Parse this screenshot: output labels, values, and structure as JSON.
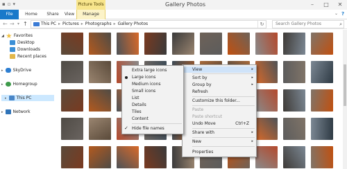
{
  "titlebar": {
    "title": "Gallery Photos",
    "contextual_tab_title": "Picture Tools",
    "qat": [
      "▪",
      "▫",
      "▾"
    ],
    "buttons": [
      "–",
      "□",
      "✕"
    ]
  },
  "ribbon": {
    "tabs": [
      "File",
      "Home",
      "Share",
      "View",
      "Manage"
    ],
    "expand_glyph": "⌄",
    "help_glyph": "?"
  },
  "address": {
    "back": "←",
    "forward": "→",
    "recent": "▾",
    "up": "↑",
    "crumbs": [
      "This PC",
      "Pictures",
      "Photographs",
      "Gallery Photos"
    ],
    "separator": "▸",
    "refresh": "↻",
    "search_placeholder": "Search Gallery Photos",
    "search_glyph": "⌕"
  },
  "nav": {
    "favorites": "Favorites",
    "desktop": "Desktop",
    "downloads": "Downloads",
    "recent_places": "Recent places",
    "skydrive": "SkyDrive",
    "homegroup": "Homegroup",
    "this_pc": "This PC",
    "network": "Network",
    "expand": "▸"
  },
  "context_menu": {
    "items": {
      "view": "View",
      "sort_by": "Sort by",
      "group_by": "Group by",
      "refresh": "Refresh",
      "customize": "Customize this folder...",
      "paste": "Paste",
      "paste_shortcut": "Paste shortcut",
      "undo_move": "Undo Move",
      "undo_shortcut": "Ctrl+Z",
      "share_with": "Share with",
      "new": "New",
      "properties": "Properties"
    },
    "arrow": "▸"
  },
  "view_submenu": {
    "items": [
      "Extra large icons",
      "Large icons",
      "Medium icons",
      "Small icons",
      "List",
      "Details",
      "Tiles",
      "Content",
      "Hide file names"
    ],
    "selected": "Large icons",
    "checked": "Hide file names",
    "check_glyph": "✓"
  },
  "thumbnail_colors": [
    "#5a4a3a",
    "#b35a1f",
    "#4d5257",
    "#7a3a20",
    "#3a3a3a",
    "#6e6258",
    "#c05010",
    "#8a8a8a",
    "#3e3a36",
    "#807468",
    "#4f4b45",
    "#9a8570",
    "#b4492c",
    "#6a6460",
    "#3c4b57",
    "#a86a3a",
    "#2e3a44",
    "#d86a2a",
    "#5c5c5c",
    "#7c8894"
  ]
}
